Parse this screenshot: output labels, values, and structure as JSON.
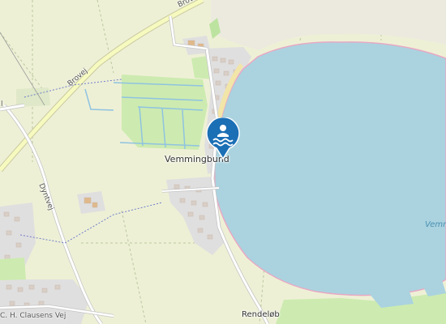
{
  "map": {
    "place_label": "Vemmingbund",
    "water_label": "Vemm",
    "road_labels": {
      "brovej_top": "Brovej",
      "brovej_mid": "Brovej",
      "dyntvej": "Dyntvej",
      "clausens": "C. H. Clausens Vej",
      "rendelob": "Rendeløb",
      "left_edge": "l"
    },
    "marker": {
      "icon": "swimming-icon",
      "color": "#1b6fb5"
    },
    "colors": {
      "land": "#eef0d6",
      "water": "#aad3df",
      "grass": "#cdebb0",
      "residential": "#e0dfdf",
      "road_yellow": "#f7fabf",
      "road_white": "#ffffff",
      "beach": "#f2e5a8"
    }
  }
}
